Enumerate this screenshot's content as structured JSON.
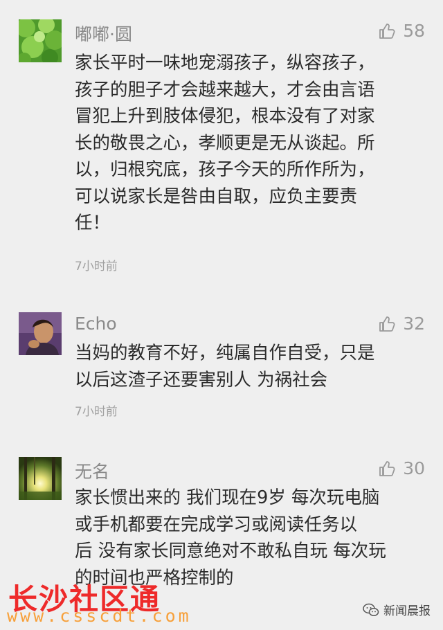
{
  "comments": [
    {
      "author": "嘟嘟·圆",
      "likes": "58",
      "text_lines": [
        "家长平时一味地宠溺孩子，纵容孩子，",
        "孩子的胆子才会越来越大，才会由言语",
        "冒犯上升到肢体侵犯，根本没有了对家",
        "长的敬畏之心，孝顺更是无从谈起。所",
        "以，归根究底，孩子今天的所作所为，",
        "可以说家长是咎由自取，应负主要责",
        "任！"
      ],
      "time": "7小时前",
      "avatar_icon": "green-leaves-avatar"
    },
    {
      "author": "Echo",
      "likes": "32",
      "text_lines": [
        "当妈的教育不好，纯属自作自受，只是",
        "以后这渣子还要害别人 为祸社会"
      ],
      "time": "7小时前",
      "avatar_icon": "person-portrait-avatar"
    },
    {
      "author": "无名",
      "likes": "30",
      "text_lines": [
        "家长惯出来的 我们现在9岁 每次玩电脑",
        "或手机都要在完成学习或阅读任务以",
        "后 没有家长同意绝对不敢私自玩 每次玩",
        "的时间也严格控制的"
      ],
      "avatar_icon": "sunlit-forest-avatar"
    }
  ],
  "watermark": {
    "site_name": "长沙社区通",
    "site_url": "www.csscdt.com",
    "account_name": "新闻晨报"
  },
  "colors": {
    "background": "#efefef",
    "author": "#8a8a8a",
    "text": "#2b2b2b",
    "time": "#a0a0a0",
    "watermark_red": "#ee2a2a",
    "watermark_orange": "#f7a03a"
  }
}
